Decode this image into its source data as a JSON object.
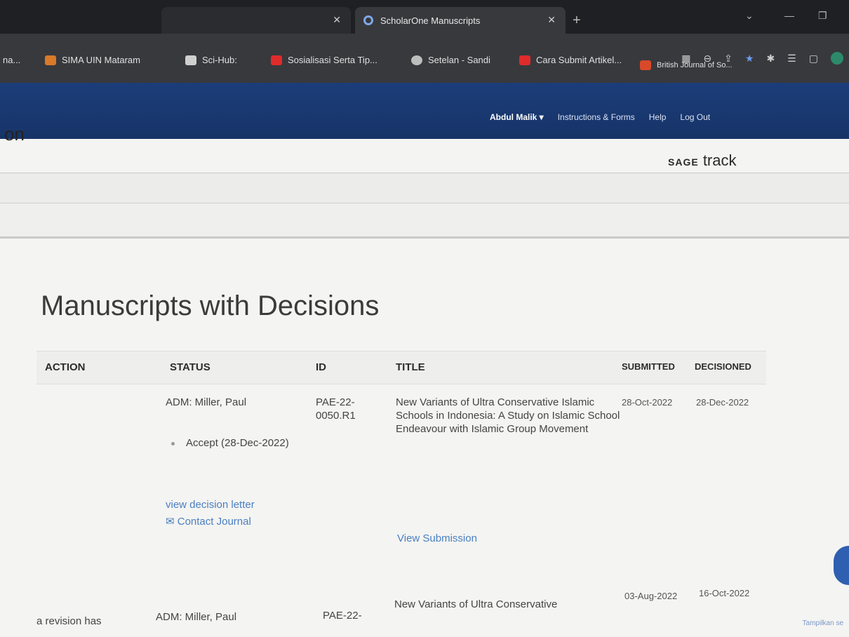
{
  "browser": {
    "tabs": [
      {
        "label": "",
        "active": false
      },
      {
        "label": "ScholarOne Manuscripts",
        "active": true
      }
    ],
    "bookmarks": [
      {
        "label": "na...",
        "icon": "generic-icon"
      },
      {
        "label": "SIMA UIN Mataram",
        "icon": "sima-icon"
      },
      {
        "label": "Sci-Hub:",
        "icon": "scihub-icon"
      },
      {
        "label": "Sosialisasi Serta Tip...",
        "icon": "youtube-icon"
      },
      {
        "label": "Setelan - Sandi",
        "icon": "gear-icon"
      },
      {
        "label": "Cara Submit Artikel...",
        "icon": "youtube-icon"
      },
      {
        "label": "British Journal of So...",
        "icon": "bookmark-icon"
      }
    ]
  },
  "header": {
    "user": "Abdul Malik ▾",
    "links": [
      "Instructions & Forms",
      "Help",
      "Log Out"
    ],
    "page_heading": "on",
    "brand": "SAGE",
    "brand_suffix": "track"
  },
  "main": {
    "title": "Manuscripts with Decisions",
    "columns": [
      "ACTION",
      "STATUS",
      "ID",
      "TITLE",
      "SUBMITTED",
      "DECISIONED"
    ],
    "rows": [
      {
        "action": "",
        "status_person": "ADM: Miller, Paul",
        "status_decision": "Accept (28-Dec-2022)",
        "status_links": [
          "view decision letter",
          "Contact Journal"
        ],
        "id": "PAE-22-0050.R1",
        "title": "New Variants of Ultra Conservative Islamic Schools in Indonesia:  A Study on Islamic School Endeavour with Islamic Group Movement",
        "title_link": "View Submission",
        "submitted": "28-Oct-2022",
        "decisioned": "28-Dec-2022"
      },
      {
        "action": "a revision has",
        "status_person": "ADM: Miller, Paul",
        "id": "PAE-22-",
        "title": "New Variants of Ultra Conservative",
        "submitted": "03-Aug-2022",
        "decisioned": "16-Oct-2022"
      }
    ],
    "footnote": "Tampilkan se"
  },
  "colors": {
    "site_header": "#1c3d7a",
    "link": "#4a7fc1",
    "page_bg": "#f4f4f2"
  }
}
